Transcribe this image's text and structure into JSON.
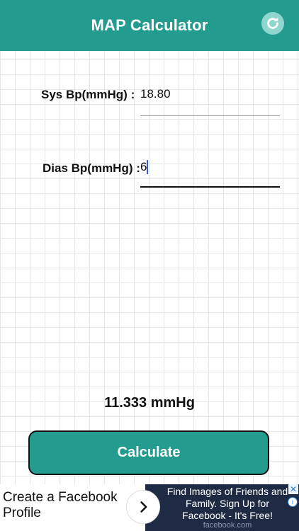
{
  "header": {
    "title": "MAP Calculator",
    "refresh_icon": "refresh-icon",
    "color": "#249b8f"
  },
  "form": {
    "systolic": {
      "label": "Sys Bp(mmHg) :",
      "value": "18.80"
    },
    "diastolic": {
      "label": "Dias Bp(mmHg) :",
      "value": "6"
    }
  },
  "result": {
    "text": "11.333 mmHg"
  },
  "actions": {
    "calculate_label": "Calculate"
  },
  "ad": {
    "left_text": "Create a Facebook Profile",
    "right_text": "Find Images of Friends and Family. Sign Up for Facebook - It's Free!",
    "source": "facebook.com",
    "close_label": "✕",
    "info_label": "i",
    "arrow_icon": "chevron-right-icon"
  }
}
